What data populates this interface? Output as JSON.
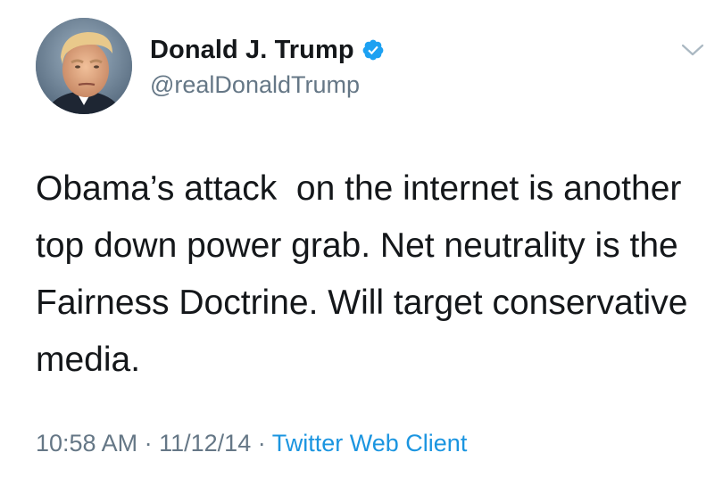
{
  "author": {
    "display_name": "Donald J. Trump",
    "handle": "@realDonaldTrump",
    "verified_icon": "verified-badge-icon",
    "avatar": "profile-photo"
  },
  "tweet": {
    "text": "Obama’s attack  on the internet is another top down power grab. Net neutrality is the Fairness Doctrine. Will target conservative media."
  },
  "meta": {
    "time": "10:58 AM",
    "separator": "·",
    "date": "11/12/14",
    "client": "Twitter Web Client"
  },
  "menu_icon": "chevron-down-icon",
  "colors": {
    "text_primary": "#14171a",
    "text_secondary": "#657786",
    "link": "#1b95e0",
    "verified": "#1da1f2"
  }
}
